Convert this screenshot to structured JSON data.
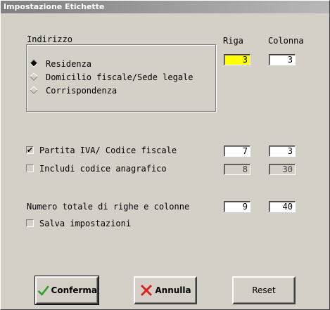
{
  "window": {
    "title": "Impostazione Etichette"
  },
  "indirizzo": {
    "label": "Indirizzo",
    "options": [
      {
        "label": "Residenza",
        "selected": true
      },
      {
        "label": "Domicilio fiscale/Sede legale",
        "selected": false
      },
      {
        "label": "Corrispondenza",
        "selected": false
      }
    ]
  },
  "columns": {
    "riga": "Riga",
    "colonna": "Colonna"
  },
  "address_pos": {
    "riga": "3",
    "colonna": "3"
  },
  "partita_iva": {
    "label": "Partita IVA/ Codice fiscale",
    "checked": true,
    "check_mark": "✔",
    "riga": "7",
    "colonna": "3"
  },
  "codice_anagrafico": {
    "label": "Includi codice anagrafico",
    "checked": false,
    "riga": "8",
    "colonna": "30"
  },
  "totale": {
    "label": "Numero totale di righe e colonne",
    "righe": "9",
    "colonne": "40"
  },
  "salva": {
    "label": "Salva impostazioni",
    "checked": false
  },
  "buttons": {
    "conferma": {
      "label": "Conferma",
      "icon": "checkmark-icon",
      "color": "#2a9d2a"
    },
    "annulla": {
      "label": "Annulla",
      "icon": "x-icon",
      "color": "#e02020"
    },
    "reset": {
      "label": "Reset"
    }
  },
  "colors": {
    "highlight_field": "#ffff00",
    "face": "#d4d0c8"
  }
}
